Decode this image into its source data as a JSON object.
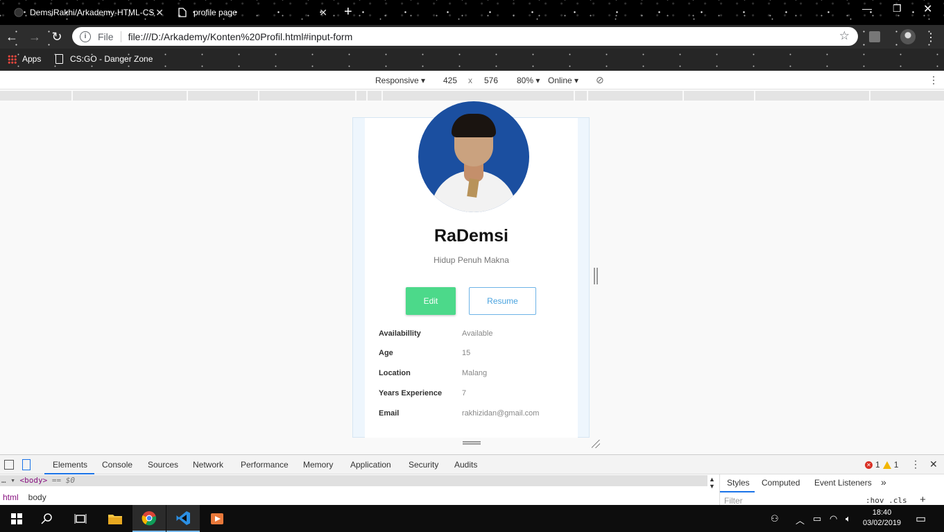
{
  "browser": {
    "tabs": [
      {
        "title": "DemsiRakhi/Arkademy-HTML-CS"
      },
      {
        "title": "profile page"
      }
    ],
    "url_scheme": "File",
    "url": "file:///D:/Arkademy/Konten%20Profil.html#input-form",
    "bookmarks": [
      {
        "label": "Apps"
      },
      {
        "label": "CS:GO - Danger Zone"
      }
    ]
  },
  "device_toolbar": {
    "mode": "Responsive",
    "width": "425",
    "times": "x",
    "height": "576",
    "zoom": "80%",
    "network": "Online"
  },
  "profile": {
    "name": "RaDemsi",
    "tagline": "Hidup Penuh Makna",
    "edit_label": "Edit",
    "resume_label": "Resume",
    "details": [
      {
        "label": "Availabillity",
        "value": "Available"
      },
      {
        "label": "Age",
        "value": "15"
      },
      {
        "label": "Location",
        "value": "Malang"
      },
      {
        "label": "Years Experience",
        "value": "7"
      },
      {
        "label": "Email",
        "value": "rakhizidan@gmail.com"
      }
    ]
  },
  "devtools": {
    "tabs": [
      "Elements",
      "Console",
      "Sources",
      "Network",
      "Performance",
      "Memory",
      "Application",
      "Security",
      "Audits"
    ],
    "active_tab": "Elements",
    "errors": "1",
    "warnings": "1",
    "selected_node": "<body>",
    "selected_suffix": "== $0",
    "breadcrumbs": [
      "html",
      "body"
    ],
    "styles_tabs": [
      "Styles",
      "Computed",
      "Event Listeners"
    ],
    "filter_placeholder": "Filter",
    "hov_cls": ":hov .cls"
  },
  "taskbar": {
    "time": "18:40",
    "date": "03/02/2019"
  },
  "colors": {
    "edit_button": "#4cd98a",
    "resume_border": "#6db3e6",
    "photo_background": "#1b4fa0",
    "devtools_accent": "#1a73e8"
  }
}
